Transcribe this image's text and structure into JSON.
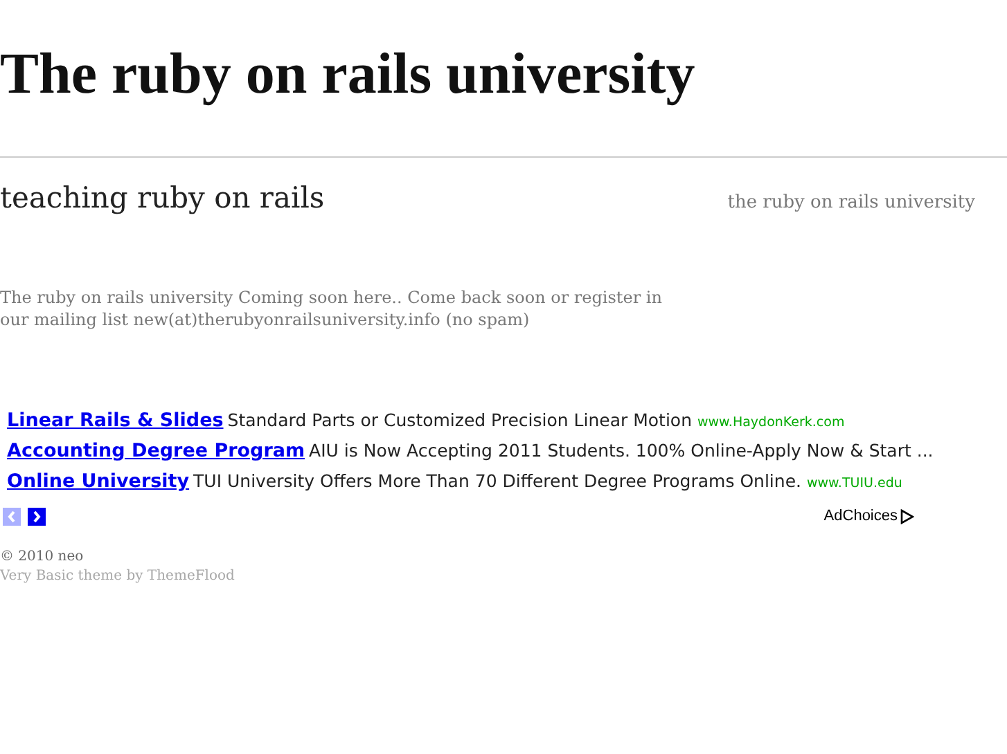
{
  "site_title": "The ruby on rails university",
  "tagline": "teaching ruby on rails",
  "header_link": "the ruby on rails university",
  "intro": "The ruby on rails university Coming soon here.. Come back soon or register in our mailing list new(at)therubyonrailsuniversity.info (no spam)",
  "ads": [
    {
      "title": "Linear Rails & Slides",
      "text": "Standard Parts or Customized Precision Linear Motion",
      "url": "www.HaydonKerk.com"
    },
    {
      "title": "Accounting Degree Program",
      "text": "AIU is Now Accepting 2011 Students. 100% Online-Apply Now & Start ..."
    },
    {
      "title": "Online University",
      "text": "TUI University Offers More Than 70 Different Degree Programs Online.",
      "url": "www.TUIU.edu"
    }
  ],
  "ad_nav": {
    "prev_disabled": true,
    "next_disabled": false
  },
  "adchoices": "AdChoices",
  "footer": {
    "copyright": "© 2010 neo",
    "credit": "Very Basic theme by ThemeFlood"
  }
}
